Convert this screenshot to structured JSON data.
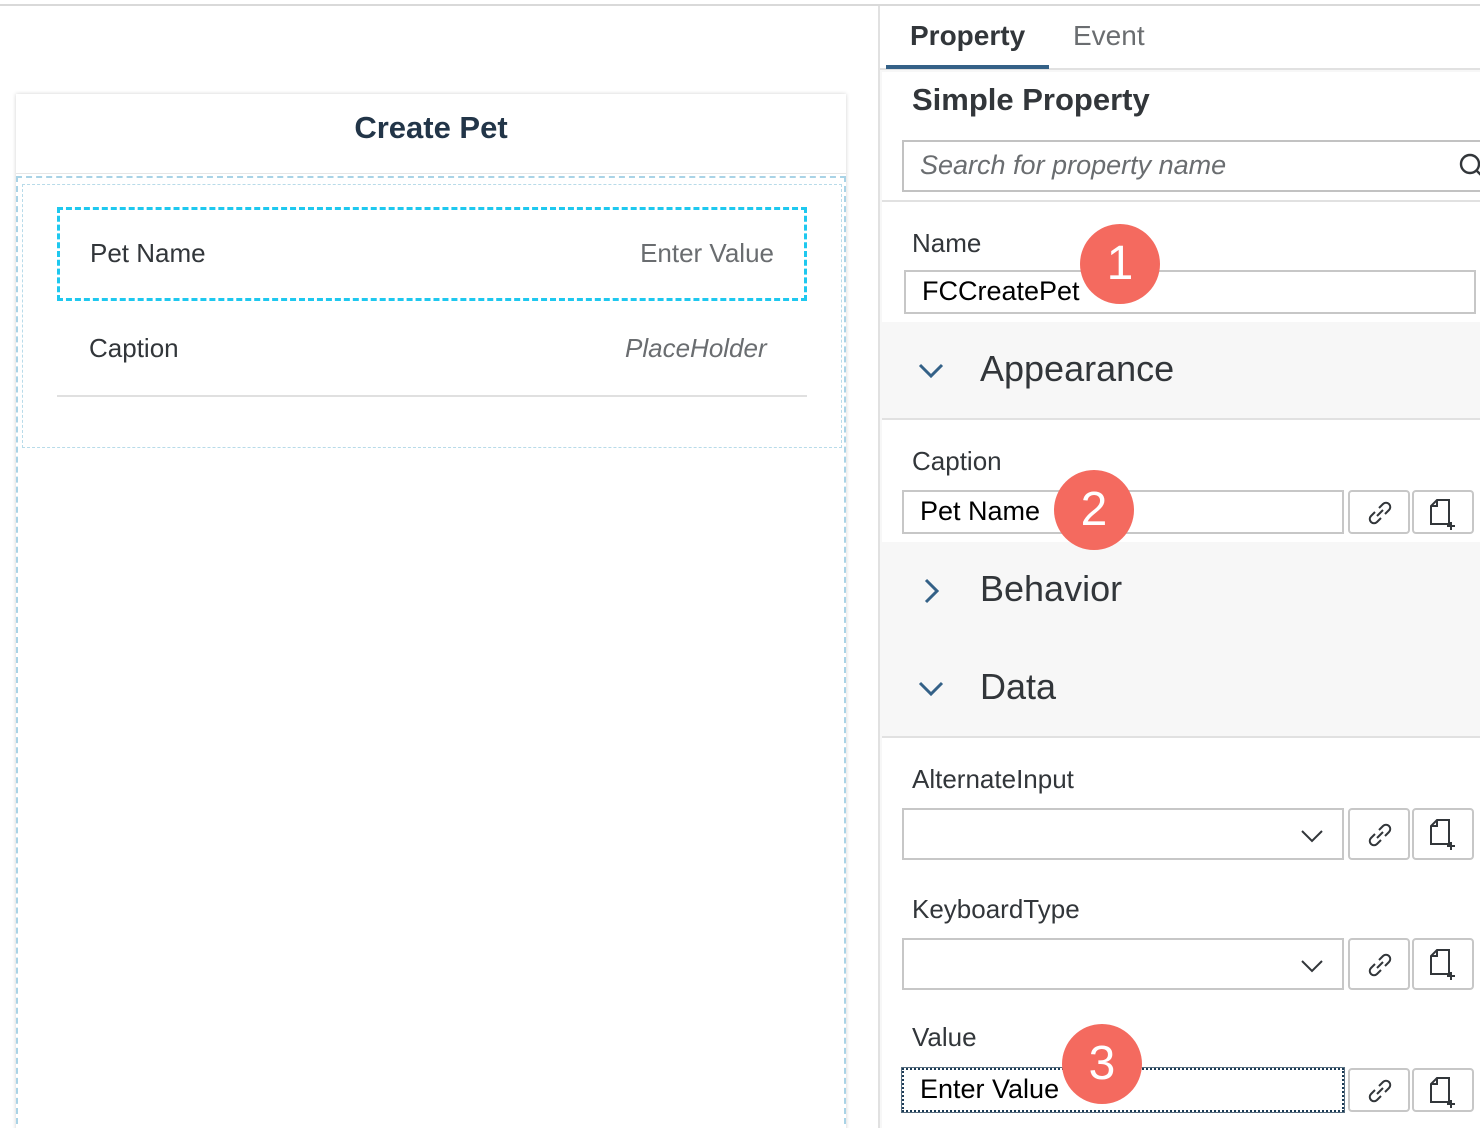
{
  "canvas": {
    "form_title": "Create Pet",
    "rows": [
      {
        "label": "Pet Name",
        "value": "Enter Value"
      },
      {
        "label": "Caption",
        "value": "PlaceHolder"
      }
    ]
  },
  "panel": {
    "tabs": [
      {
        "label": "Property",
        "active": true
      },
      {
        "label": "Event",
        "active": false
      }
    ],
    "heading": "Simple Property",
    "search": {
      "placeholder": "Search for property name"
    },
    "name": {
      "label": "Name",
      "value": "FCCreatePet"
    },
    "groups": {
      "appearance": "Appearance",
      "behavior": "Behavior",
      "data": "Data"
    },
    "caption": {
      "label": "Caption",
      "value": "Pet Name"
    },
    "alternate_input": {
      "label": "AlternateInput",
      "value": ""
    },
    "keyboard_type": {
      "label": "KeyboardType",
      "value": ""
    },
    "value": {
      "label": "Value",
      "value": "Enter Value"
    }
  },
  "badges": [
    "1",
    "2",
    "3"
  ],
  "colors": {
    "badge": "#f46a5f",
    "selection_border": "#1ec8ef",
    "tab_underline": "#346187"
  }
}
